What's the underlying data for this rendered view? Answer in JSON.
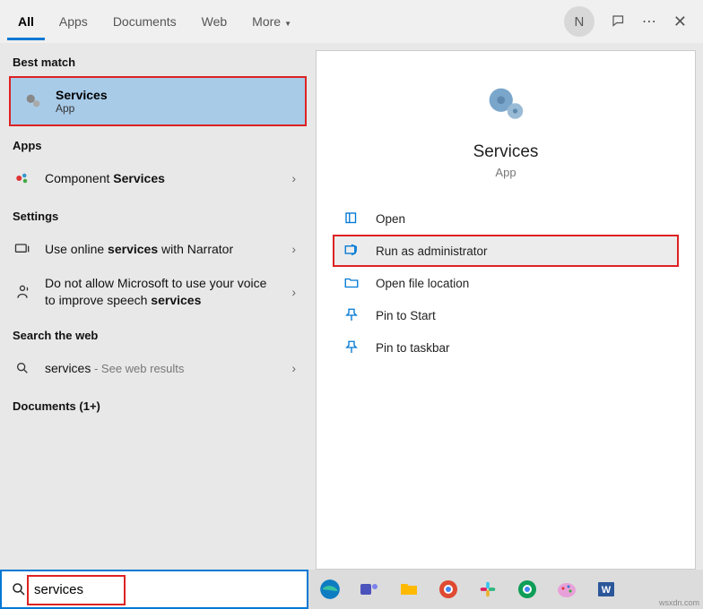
{
  "tabs": {
    "all": "All",
    "apps": "Apps",
    "documents": "Documents",
    "web": "Web",
    "more": "More"
  },
  "section": {
    "best": "Best match",
    "apps": "Apps",
    "settings": "Settings",
    "web": "Search the web",
    "docs": "Documents (1+)"
  },
  "best": {
    "title": "Services",
    "sub": "App"
  },
  "appsRow": {
    "prefix": "Component ",
    "bold": "Services"
  },
  "settings1": {
    "pre": "Use online ",
    "bold": "services",
    "post": " with Narrator"
  },
  "settings2": {
    "pre": "Do not allow Microsoft to use your voice to improve speech ",
    "bold": "services"
  },
  "webRow": {
    "term": "services",
    "hint": " - See web results"
  },
  "preview": {
    "title": "Services",
    "sub": "App"
  },
  "actions": {
    "open": "Open",
    "admin": "Run as administrator",
    "loc": "Open file location",
    "pinstart": "Pin to Start",
    "pintask": "Pin to taskbar"
  },
  "search": {
    "value": "services"
  },
  "user": {
    "initial": "N"
  },
  "watermark": "wsxdn.com"
}
